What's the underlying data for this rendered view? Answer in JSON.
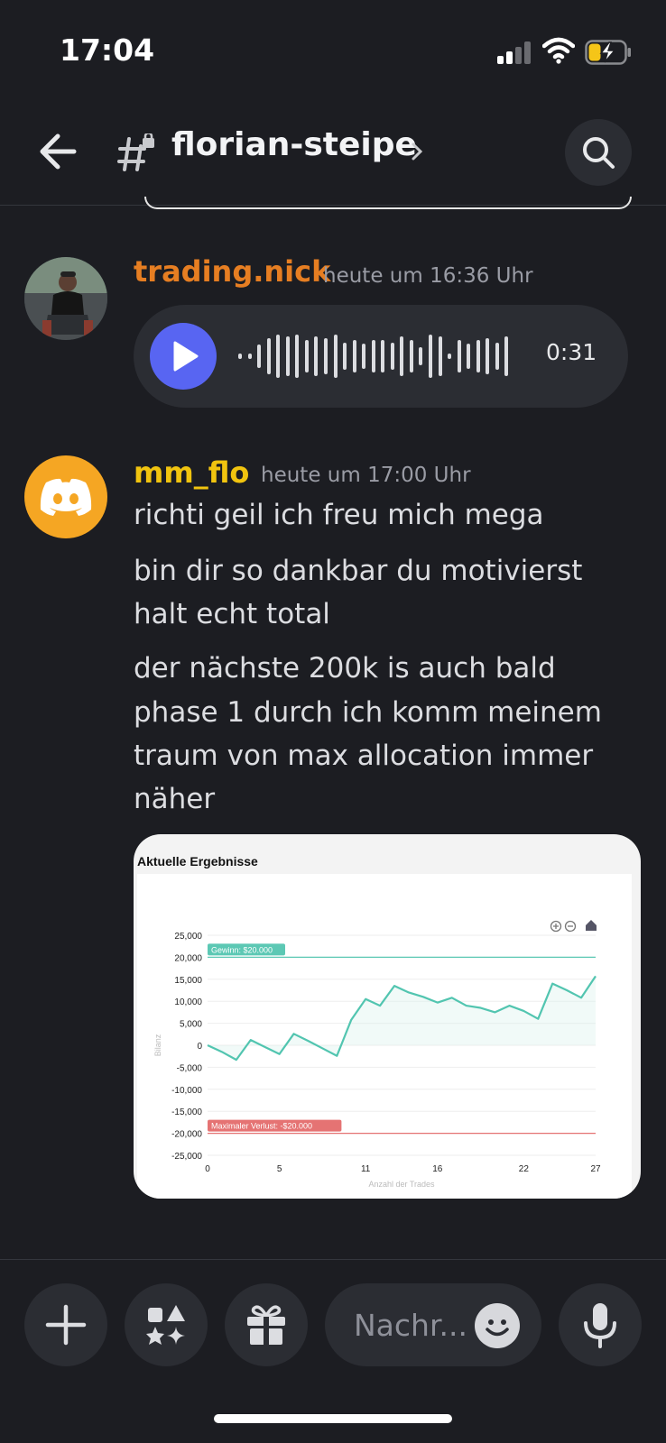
{
  "status_bar": {
    "time": "17:04"
  },
  "header": {
    "channel_name": "florian-steipe"
  },
  "messages": [
    {
      "username": "trading.nick",
      "username_color": "#e67e22",
      "timestamp": "heute um 16:36 Uhr",
      "voice_duration": "0:31"
    },
    {
      "username": "mm_flo",
      "username_color": "#f1c40f",
      "timestamp": "heute um 17:00 Uhr",
      "lines": [
        "richti geil ich freu mich mega",
        "bin dir so dankbar du motivierst",
        "halt echt total",
        "der nächste 200k is auch bald",
        "phase 1 durch ich komm meinem",
        "traum von max allocation immer",
        "näher"
      ]
    }
  ],
  "attachment": {
    "title": "Aktuelle Ergebnisse",
    "chart_data": {
      "type": "line",
      "ylabel": "Bilanz",
      "xlabel": "Anzahl der Trades",
      "ylim": [
        -25000,
        25000
      ],
      "y_ticks": [
        "25,000",
        "20,000",
        "15,000",
        "10,000",
        "5,000",
        "0",
        "-5,000",
        "-10,000",
        "-15,000",
        "-20,000",
        "-25,000"
      ],
      "x_ticks": [
        "0",
        "5",
        "11",
        "16",
        "22",
        "27"
      ],
      "xlim": [
        0,
        27
      ],
      "x": [
        0,
        1,
        2,
        3,
        4,
        5,
        6,
        7,
        8,
        9,
        10,
        11,
        12,
        13,
        14,
        15,
        16,
        17,
        18,
        19,
        20,
        21,
        22,
        23,
        24,
        25,
        26,
        27
      ],
      "y": [
        0,
        -1500,
        -3300,
        1200,
        -400,
        -2000,
        2600,
        1000,
        -700,
        -2400,
        5800,
        10500,
        9000,
        13500,
        12000,
        11000,
        9700,
        10800,
        9000,
        8500,
        7500,
        9000,
        7800,
        6000,
        14000,
        12500,
        10800,
        15700
      ],
      "profit_line": {
        "value": 20000,
        "label": "Gewinn: $20.000",
        "color": "#5cc8b4"
      },
      "loss_line": {
        "value": -20000,
        "label": "Maximaler Verlust: -$20.000",
        "color": "#e57373"
      },
      "series_color": "#52c5b0"
    }
  },
  "composer": {
    "placeholder": "Nachr..."
  }
}
